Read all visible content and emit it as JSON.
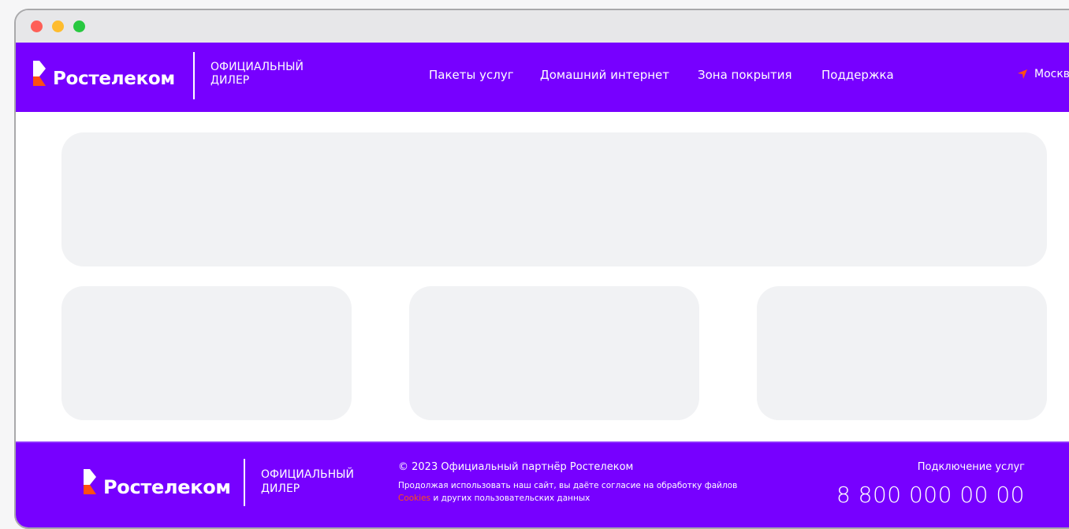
{
  "window": {
    "controls": [
      "close",
      "minimize",
      "maximize"
    ]
  },
  "brand": {
    "name": "Ростелеком",
    "dealer_line1": "ОФИЦИАЛЬНЫЙ",
    "dealer_line2": "ДИЛЕР",
    "colors": {
      "primary": "#7700ff",
      "accent": "#ff4f12",
      "card": "#f1f2f4"
    }
  },
  "header": {
    "nav": [
      {
        "label": "Пакеты услуг"
      },
      {
        "label": "Домашний интернет"
      },
      {
        "label": "Зона покрытия"
      },
      {
        "label": "Поддержка"
      }
    ],
    "city_icon": "location-arrow-icon",
    "city": "Москв"
  },
  "footer": {
    "copyright": "© 2023 Официальный партнёр Ростелеком",
    "consent_text": "Продолжая использовать наш сайт, вы даёте согласие на обработку файлов",
    "cookies_link": "Cookies",
    "consent_tail": "и других пользовательских данных",
    "connect_label": "Подключение услуг",
    "phone": "8 800 000 00 00"
  }
}
